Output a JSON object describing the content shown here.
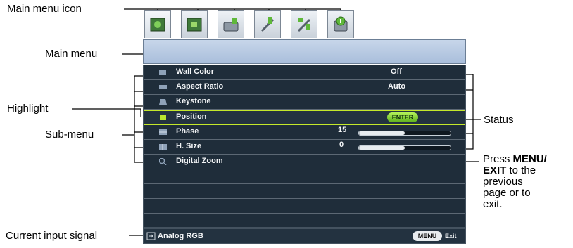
{
  "callouts": {
    "main_menu_icon": "Main menu icon",
    "main_menu": "Main menu",
    "highlight": "Highlight",
    "sub_menu": "Sub-menu",
    "status": "Status",
    "press_pre": "Press ",
    "press_bold1": "MENU/",
    "press_bold2": "EXIT",
    "press_rest1": " to the",
    "press_line3": "previous",
    "press_line4": "page or to",
    "press_line5": "exit.",
    "current_input": "Current input signal"
  },
  "tabs": [
    {
      "icon": "picture-tab-icon",
      "active": true
    },
    {
      "icon": "picture-advanced-tab-icon"
    },
    {
      "icon": "display-tab-icon"
    },
    {
      "icon": "settings-basic-tab-icon"
    },
    {
      "icon": "settings-advanced-tab-icon"
    },
    {
      "icon": "information-tab-icon"
    }
  ],
  "menu": {
    "items": [
      {
        "label": "Wall Color",
        "value": "Off",
        "icon": "wall-color-icon"
      },
      {
        "label": "Aspect Ratio",
        "value": "Auto",
        "icon": "aspect-ratio-icon"
      },
      {
        "label": "Keystone",
        "value": "",
        "icon": "keystone-icon"
      },
      {
        "label": "Position",
        "value": "",
        "enter": "ENTER",
        "icon": "position-icon",
        "highlight": true
      },
      {
        "label": "Phase",
        "value": "15",
        "level": 0.5,
        "icon": "phase-icon"
      },
      {
        "label": "H. Size",
        "value": "0",
        "level": 0.5,
        "icon": "h-size-icon"
      },
      {
        "label": "Digital Zoom",
        "value": "",
        "icon": "digital-zoom-icon"
      }
    ],
    "input_signal": "Analog RGB",
    "menu_button": "MENU",
    "exit_label": "Exit"
  },
  "colors": {
    "highlight": "#c4e82a",
    "menu_bg": "#1f2d3a",
    "title_bar": "#b8c9e2"
  }
}
